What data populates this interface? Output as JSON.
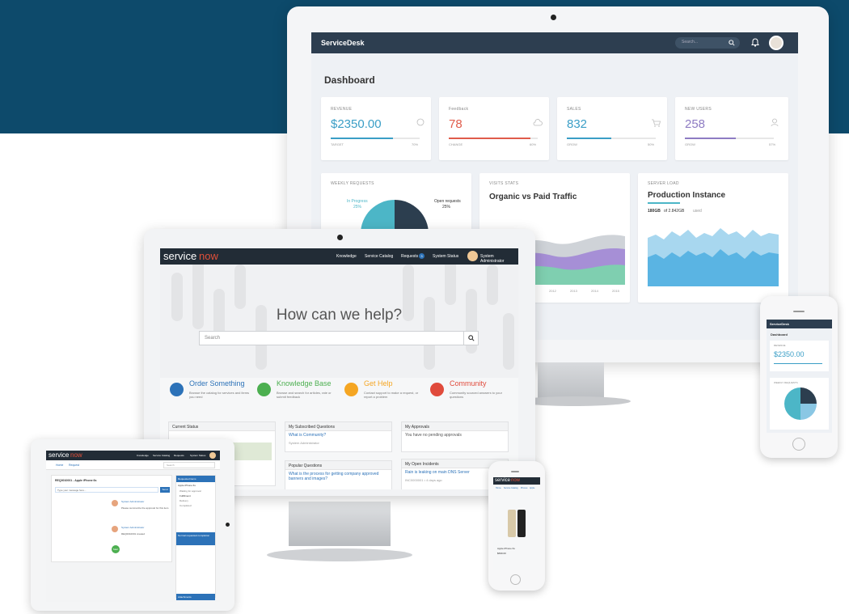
{
  "servicedesk": {
    "brand": "ServiceDesk",
    "search_placeholder": "Search...",
    "page_title": "Dashboard",
    "kpis": [
      {
        "label": "REVENUE",
        "value": "$2350.00",
        "foot_left": "TARGET",
        "foot_right": "70%",
        "color": "#3a9ec6"
      },
      {
        "label": "Feedback",
        "value": "78",
        "foot_left": "CHANGE",
        "foot_right": "60%",
        "color": "#e05c4b"
      },
      {
        "label": "SALES",
        "value": "832",
        "foot_left": "GROW",
        "foot_right": "50%",
        "color": "#3a9ec6"
      },
      {
        "label": "NEW USERS",
        "value": "258",
        "foot_left": "GROW",
        "foot_right": "57%",
        "color": "#8e7cc3"
      }
    ],
    "weekly_requests": {
      "label": "WEEKLY REQUESTS",
      "in_progress": "In Progress",
      "in_progress_pct": "25%",
      "open": "Open requests",
      "open_pct": "25%"
    },
    "visits": {
      "label": "VISITS STATS",
      "title": "Organic vs Paid Traffic",
      "years": [
        "2011",
        "2012",
        "2013",
        "2014",
        "2015"
      ]
    },
    "server": {
      "label": "SERVER LOAD",
      "title": "Production Instance",
      "used": "180GB",
      "total": "of 2.842GB",
      "unit": "used"
    }
  },
  "servicenow": {
    "logo_a": "service",
    "logo_b": "now",
    "nav": [
      "Knowledge",
      "Service Catalog",
      "Requests",
      "System Status",
      "System Administrator"
    ],
    "requests_badge": "3",
    "hero_title": "How can we help?",
    "search_placeholder": "Search",
    "services": [
      {
        "title": "Order Something",
        "desc": "Browse the catalog for services and items you need",
        "color": "#2c72b8"
      },
      {
        "title": "Knowledge Base",
        "desc": "Browse and search for articles, rate or submit feedback",
        "color": "#4caf50"
      },
      {
        "title": "Get Help",
        "desc": "Contact support to make a request, or report a problem",
        "color": "#f5a623"
      },
      {
        "title": "Community",
        "desc": "Community sourced answers to your questions",
        "color": "#e04b3c"
      }
    ],
    "current_status": "Current Status",
    "subscribed": {
      "title": "My Subscribed Questions",
      "item": "What is Community?",
      "meta": "System Administrator"
    },
    "popular": {
      "title": "Popular Questions",
      "item": "What is the process for getting company approved banners and images?"
    },
    "approvals": {
      "title": "My Approvals",
      "text": "You have no pending approvals"
    },
    "incidents": {
      "title": "My Open Incidents",
      "item": "Rain is leaking on main DNS Server",
      "meta": "INC0000001 • 4 days ago"
    }
  },
  "tablet": {
    "logo_a": "service",
    "logo_b": "now",
    "nav": [
      "Knowledge",
      "Service Catalog",
      "Requests",
      "System Status"
    ],
    "breadcrumb": [
      "Home",
      "Request"
    ],
    "search_placeholder": "Search",
    "item_title": "REQ0010001 - Apple iPhone 6s",
    "comment_placeholder": "Type your message here...",
    "send_label": "Send",
    "entries": [
      {
        "name": "System Administrator",
        "text": "Please summarize the approval for this item"
      },
      {
        "name": "System Administrator",
        "text": "REQ0010001 created"
      }
    ],
    "side_title": "Requested items",
    "side_item": "Apple iPhone 6s",
    "stages": [
      "Waiting for approval",
      "Fulfillment",
      "Delivery",
      "Completed"
    ],
    "side_box": "Normal requested completion",
    "attachments": "Attachments",
    "start": "Start"
  },
  "phone_right": {
    "brand": "ServiceDesk",
    "title": "Dashboard",
    "kpi_label": "REVENUE",
    "kpi_value": "$2350.00",
    "chart_label": "WEEKLY REQUESTS"
  },
  "phone_small": {
    "logo_a": "service",
    "logo_b": "now",
    "links": [
      "Home",
      "Service Catalog",
      "Phones",
      "Apple"
    ],
    "product": "Apple iPhone 6s",
    "price": "$699.00"
  }
}
